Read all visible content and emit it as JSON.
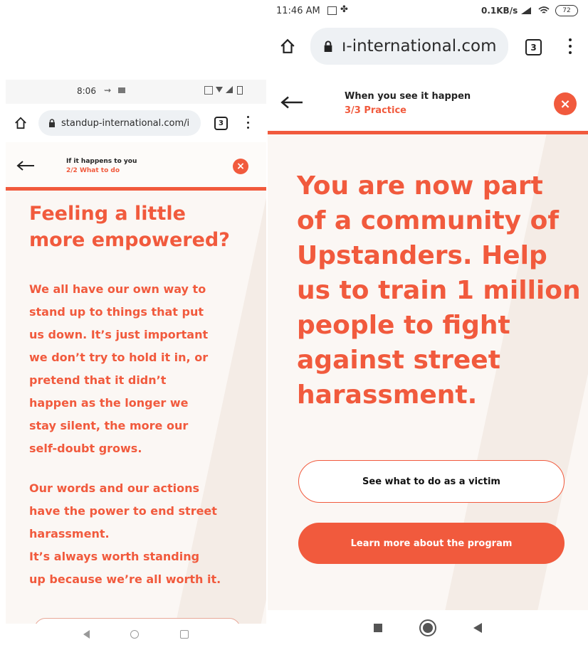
{
  "left_screen": {
    "status": {
      "time": "8:06"
    },
    "browser": {
      "url": "standup-international.com/i",
      "tab_count": "3"
    },
    "header": {
      "title": "If it happens to you",
      "subtitle": "2/2 What to do"
    },
    "close_symbol": "×",
    "headline_lines": [
      "Feeling a little",
      "more empowered?"
    ],
    "paragraph1_lines": [
      "We all have our own way to",
      "stand up to things that put",
      "us down. It’s just important",
      "we don’t try to hold it in, or",
      "pretend that it didn’t",
      "happen as the longer we",
      "stay silent, the more our",
      "self-doubt grows."
    ],
    "paragraph2_lines": [
      "Our words and our actions",
      "have the power to end street",
      "harassment.",
      "It’s always worth standing",
      "up because we’re all worth it."
    ]
  },
  "right_screen": {
    "status": {
      "time": "11:46 AM",
      "network_speed": "0.1KB/s",
      "battery": "72"
    },
    "browser": {
      "url": "ı-international.com",
      "tab_count": "3"
    },
    "header": {
      "title": "When you see it happen",
      "subtitle": "3/3 Practice"
    },
    "close_symbol": "×",
    "headline_lines": [
      "You are now part",
      "of a community of",
      "Upstanders. Help",
      "us to train 1 million",
      "people to fight",
      "against street",
      "harassment."
    ],
    "victim_button_label": "See what to do as a victim",
    "program_button_label": "Learn more about the program"
  },
  "colors": {
    "accent": "#f15a3d",
    "content_bg": "#fbf7f4",
    "url_pill": "#eef1f4"
  },
  "icons": [
    "home-icon",
    "lock-icon",
    "back-arrow-icon",
    "close-icon",
    "wifi-icon",
    "battery-icon",
    "nav-back-icon",
    "nav-home-icon",
    "nav-recents-icon"
  ]
}
